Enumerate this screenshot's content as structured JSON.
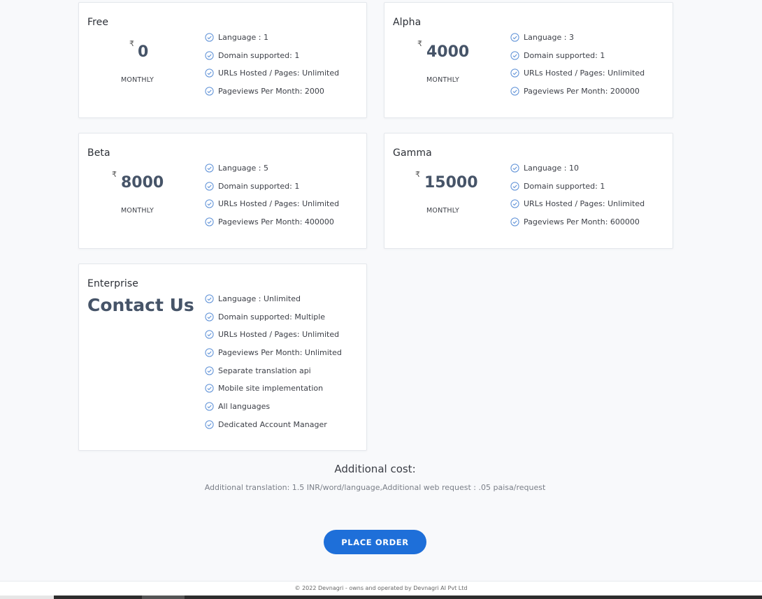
{
  "currency_symbol": "₹",
  "period_label": "MONTHLY",
  "plans": [
    {
      "name": "Free",
      "price": "0",
      "features": [
        "Language : 1",
        "Domain supported: 1",
        "URLs Hosted / Pages: Unlimited",
        "Pageviews Per Month: 2000"
      ]
    },
    {
      "name": "Alpha",
      "price": "4000",
      "features": [
        "Language : 3",
        "Domain supported: 1",
        "URLs Hosted / Pages: Unlimited",
        "Pageviews Per Month: 200000"
      ]
    },
    {
      "name": "Beta",
      "price": "8000",
      "features": [
        "Language : 5",
        "Domain supported: 1",
        "URLs Hosted / Pages: Unlimited",
        "Pageviews Per Month: 400000"
      ]
    },
    {
      "name": "Gamma",
      "price": "15000",
      "features": [
        "Language : 10",
        "Domain supported: 1",
        "URLs Hosted / Pages: Unlimited",
        "Pageviews Per Month: 600000"
      ]
    },
    {
      "name": "Enterprise",
      "price": "Contact Us",
      "features": [
        "Language : Unlimited",
        "Domain supported: Multiple",
        "URLs Hosted / Pages: Unlimited",
        "Pageviews Per Month: Unlimited",
        "Separate translation api",
        "Mobile site implementation",
        "All languages",
        "Dedicated Account Manager"
      ]
    }
  ],
  "additional": {
    "title": "Additional cost:",
    "text": "Additional translation: 1.5 INR/word/language,Additional web request : .05 paisa/request"
  },
  "order_button_label": "PLACE ORDER",
  "footer_text": "© 2022 Devnagri - owns and operated by Devnagri AI Pvt Ltd",
  "colors": {
    "accent": "#1e6fd9",
    "price": "#465468",
    "check_icon": "#5b8fd6"
  }
}
